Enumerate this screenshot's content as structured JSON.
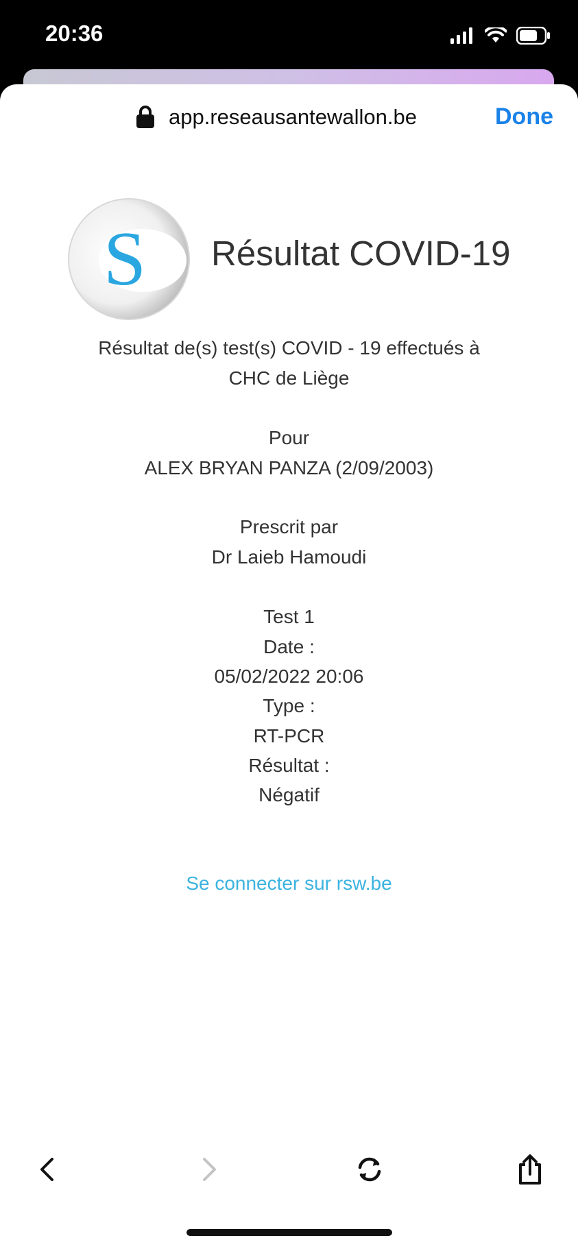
{
  "status_bar": {
    "time": "20:36",
    "icons": [
      "cellular-signal-icon",
      "wifi-icon",
      "battery-icon"
    ]
  },
  "browser": {
    "url": "app.reseausantewallon.be",
    "done_label": "Done",
    "accent_color": "#1a82e8",
    "toolbar_icons": [
      "back-arrow-icon",
      "forward-arrow-icon",
      "refresh-icon",
      "share-icon"
    ]
  },
  "page": {
    "logo_letter": "S",
    "title": "Résultat COVID-19",
    "intro": "Résultat de(s) test(s) COVID - 19 effectués à",
    "location": "CHC de Liège",
    "for_label": "Pour",
    "patient": "ALEX BRYAN PANZA (2/09/2003)",
    "prescribed_label": "Prescrit par",
    "doctor": "Dr Laieb Hamoudi",
    "test": {
      "name": "Test 1",
      "date_label": "Date :",
      "date_value": "05/02/2022 20:06",
      "type_label": "Type :",
      "type_value": "RT-PCR",
      "result_label": "Résultat :",
      "result_value": "Négatif"
    },
    "login_link": "Se connecter sur rsw.be",
    "link_color": "#3cb3e0"
  }
}
